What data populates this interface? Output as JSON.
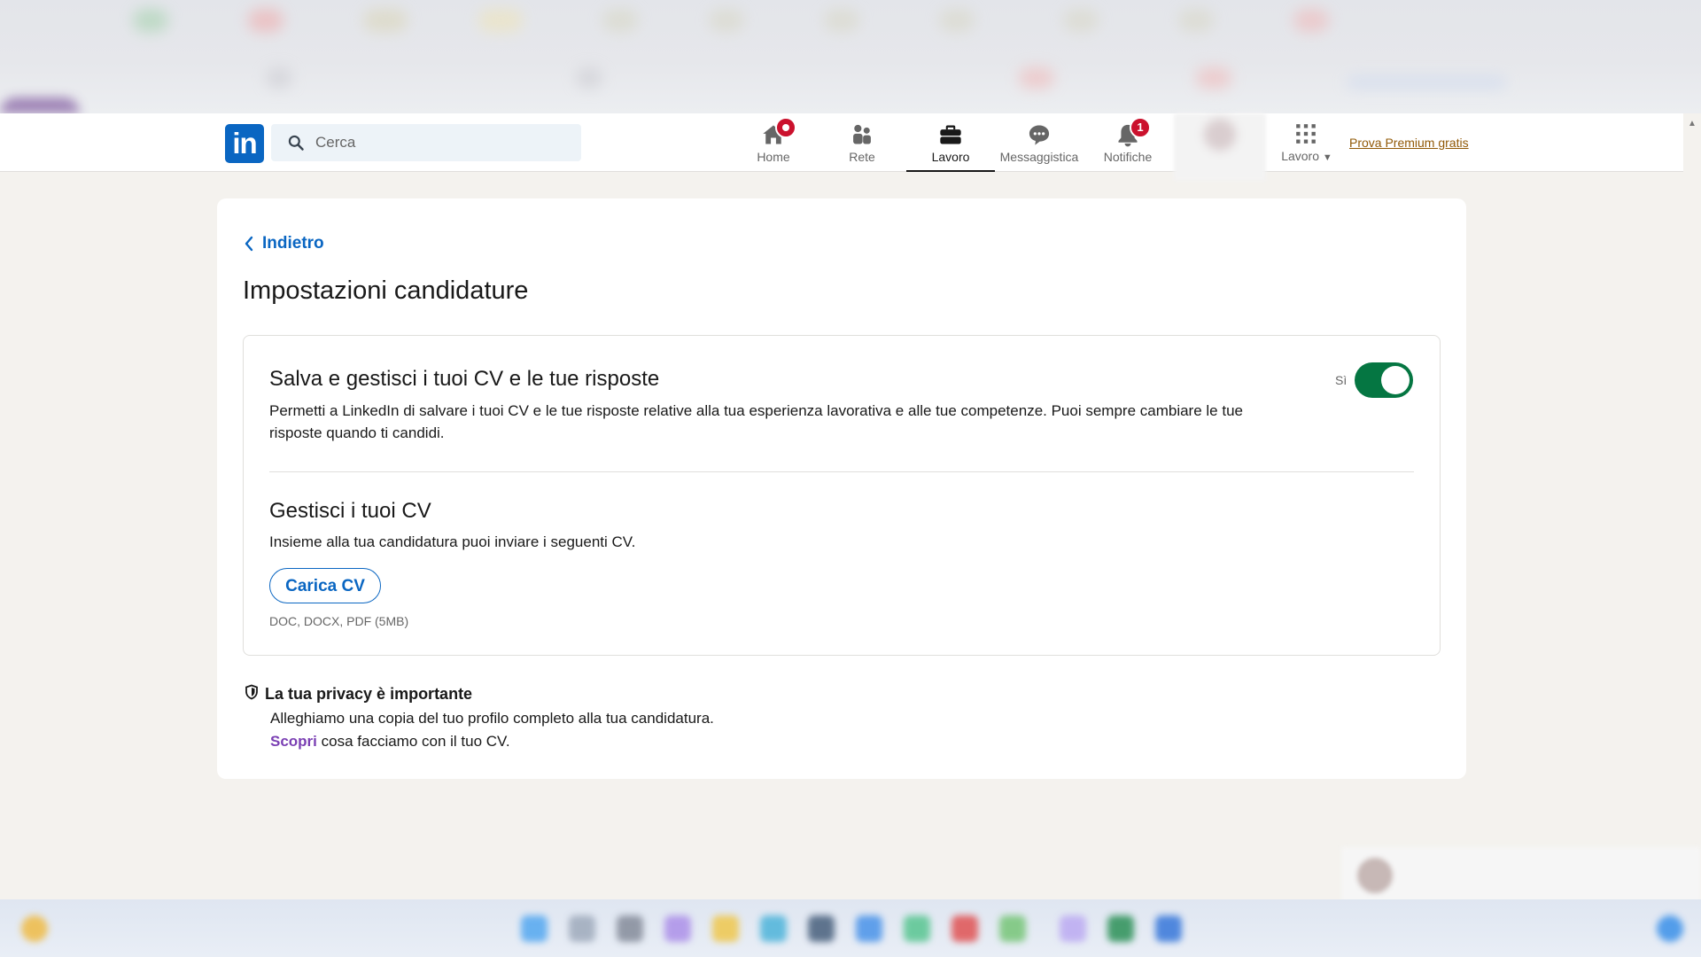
{
  "navbar": {
    "search_placeholder": "Cerca",
    "items": [
      {
        "label": "Home",
        "icon": "home-icon",
        "badge": ""
      },
      {
        "label": "Rete",
        "icon": "network-icon",
        "badge": ""
      },
      {
        "label": "Lavoro",
        "icon": "briefcase-icon",
        "badge": "",
        "active": true
      },
      {
        "label": "Messaggistica",
        "icon": "messaging-icon",
        "badge": ""
      },
      {
        "label": "Notifiche",
        "icon": "bell-icon",
        "badge": "1"
      }
    ],
    "work_menu_label": "Lavoro",
    "premium_link": "Prova Premium gratis"
  },
  "page": {
    "back_label": "Indietro",
    "title": "Impostazioni candidature",
    "save_section": {
      "title": "Salva e gestisci i tuoi CV e le tue risposte",
      "description": "Permetti a LinkedIn di salvare i tuoi CV e le tue risposte relative alla tua esperienza lavorativa e alle tue competenze. Puoi sempre cambiare le tue risposte quando ti candidi.",
      "toggle_label": "Sì",
      "toggle_on": true
    },
    "cv_section": {
      "title": "Gestisci i tuoi CV",
      "description": "Insieme alla tua candidatura puoi inviare i seguenti CV.",
      "upload_button": "Carica CV",
      "file_hint": "DOC, DOCX, PDF (5MB)"
    },
    "privacy": {
      "title": "La tua privacy è importante",
      "line1": "Alleghiamo una copia del tuo profilo completo alla tua candidatura.",
      "link": "Scopri",
      "line2_rest": " cosa facciamo con il tuo CV."
    }
  },
  "colors": {
    "brand": "#0a66c2",
    "toggle_on": "#057642",
    "badge": "#cb112d",
    "premium": "#915907",
    "visited_link": "#7a3fb3",
    "background": "#f4f2ee"
  }
}
